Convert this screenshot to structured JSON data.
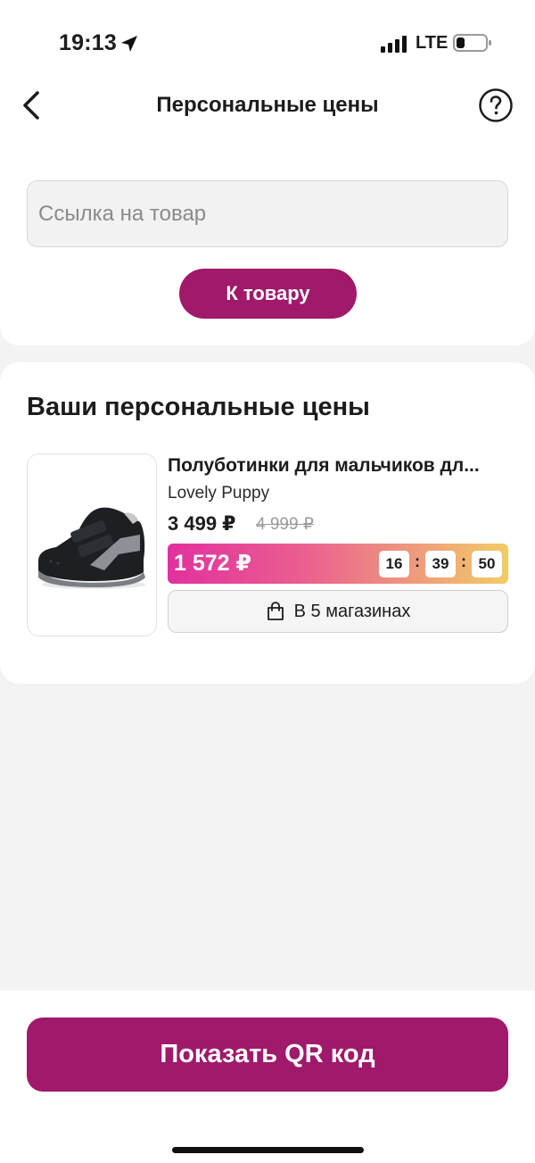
{
  "status_bar": {
    "time": "19:13",
    "network": "LTE",
    "icons": [
      "location-arrow-icon",
      "signal-icon",
      "battery-icon"
    ]
  },
  "header": {
    "title": "Персональные цены",
    "back_icon": "chevron-left-icon",
    "help_icon": "question-circle-icon"
  },
  "search": {
    "placeholder": "Ссылка на товар",
    "value": "",
    "button_label": "К товару"
  },
  "personal_prices": {
    "title": "Ваши персональные цены",
    "items": [
      {
        "name": "Полуботинки для мальчиков дл...",
        "brand": "Lovely Puppy",
        "price": "3 499 ₽",
        "old_price": "4 999 ₽",
        "personal_price": "1 572 ₽",
        "timer": {
          "hours": "16",
          "minutes": "39",
          "seconds": "50",
          "separator": ":"
        },
        "stores_label": "В 5 магазинах",
        "stores_icon": "shopping-bag-icon"
      }
    ]
  },
  "footer": {
    "qr_button_label": "Показать QR код"
  },
  "colors": {
    "brand": "#a0196a",
    "background": "#f3f3f3",
    "promo_gradient": [
      "#e2309e",
      "#ea5f90",
      "#ee9a7c",
      "#f2cc66"
    ],
    "old_price": "#9a9a9a"
  }
}
